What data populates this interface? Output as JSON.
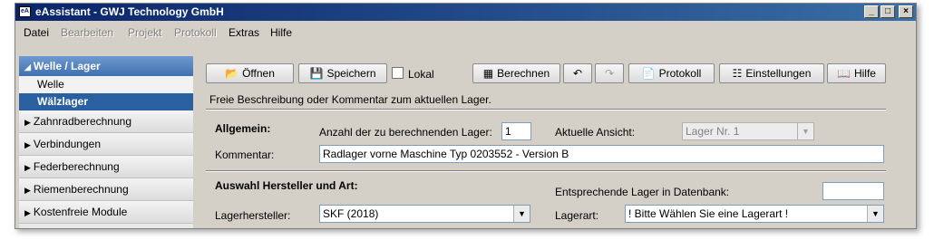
{
  "window": {
    "icon_text": "eA",
    "title": "eAssistant - GWJ Technology GmbH",
    "controls": [
      "_",
      "□",
      "×"
    ]
  },
  "menu": {
    "items": [
      "Datei",
      "Bearbeiten",
      "Projekt",
      "Protokoll",
      "Extras",
      "Hilfe"
    ]
  },
  "sidebar": {
    "header": "Welle / Lager",
    "subitems": [
      "Welle",
      "Wälzlager"
    ],
    "items": [
      "Zahnradberechnung",
      "Verbindungen",
      "Federberechnung",
      "Riemenberechnung",
      "Kostenfreie Module"
    ]
  },
  "toolbar": {
    "open": "Öffnen",
    "save": "Speichern",
    "local": "Lokal",
    "calculate": "Berechnen",
    "protocol": "Protokoll",
    "settings": "Einstellungen",
    "help": "Hilfe"
  },
  "description": "Freie Beschreibung oder Kommentar zum aktuellen Lager.",
  "general": {
    "heading": "Allgemein:",
    "count_label": "Anzahl der zu berechnenden Lager:",
    "count_value": "1",
    "view_label": "Aktuelle Ansicht:",
    "view_value": "Lager Nr. 1",
    "comment_label": "Kommentar:",
    "comment_value": "Radlager vorne Maschine Typ 0203552 - Version B"
  },
  "selection": {
    "heading": "Auswahl Hersteller und Art:",
    "db_label": "Entsprechende Lager in Datenbank:",
    "db_value": "",
    "manufacturer_label": "Lagerhersteller:",
    "manufacturer_value": "SKF (2018)",
    "type_label": "Lagerart:",
    "type_value": "! Bitte Wählen Sie eine Lagerart !"
  }
}
